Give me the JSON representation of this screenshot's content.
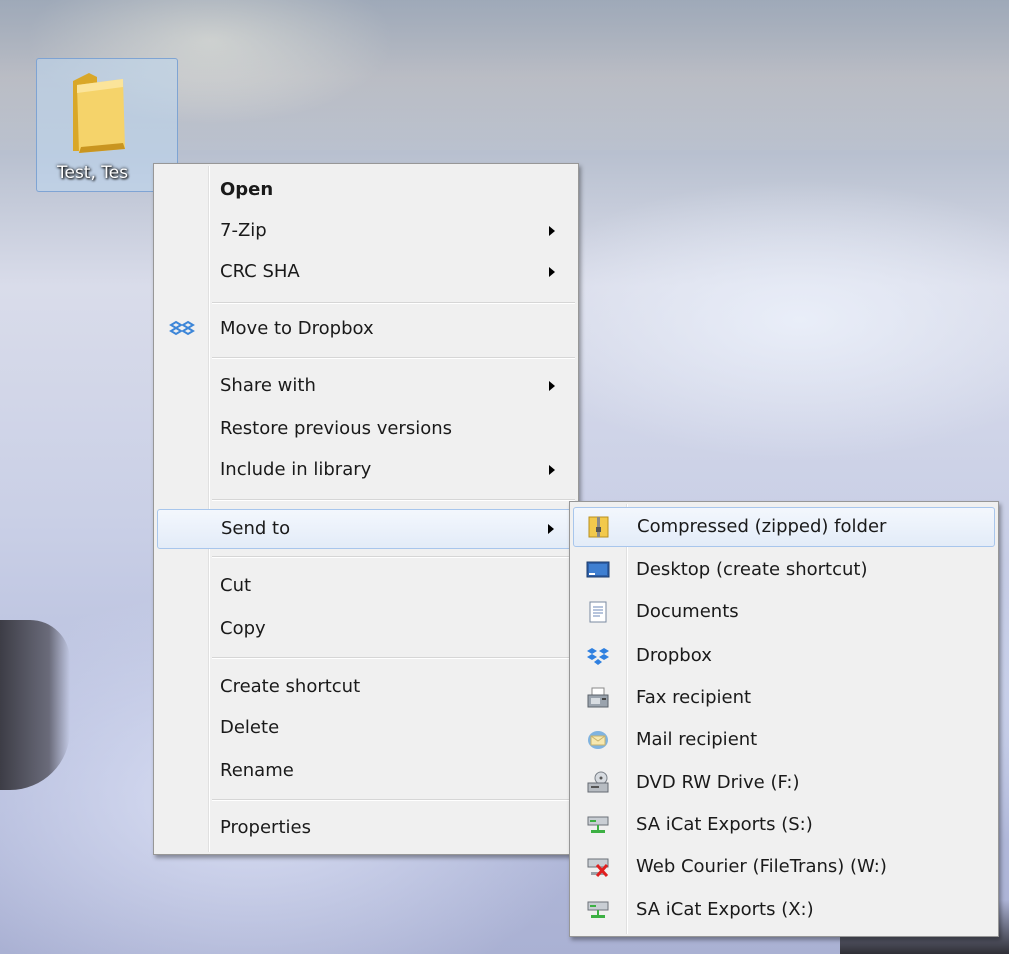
{
  "desktop": {
    "icon_label": "Test, Tes"
  },
  "context_menu": {
    "items": [
      {
        "label": "Open"
      },
      {
        "label": "7-Zip"
      },
      {
        "label": "CRC SHA"
      },
      {
        "label": "Move to Dropbox"
      },
      {
        "label": "Share with"
      },
      {
        "label": "Restore previous versions"
      },
      {
        "label": "Include in library"
      },
      {
        "label": "Send to"
      },
      {
        "label": "Cut"
      },
      {
        "label": "Copy"
      },
      {
        "label": "Create shortcut"
      },
      {
        "label": "Delete"
      },
      {
        "label": "Rename"
      },
      {
        "label": "Properties"
      }
    ]
  },
  "send_to_menu": {
    "items": [
      {
        "label": "Compressed (zipped) folder",
        "icon": "zip-folder-icon"
      },
      {
        "label": "Desktop (create shortcut)",
        "icon": "desktop-icon"
      },
      {
        "label": "Documents",
        "icon": "document-icon"
      },
      {
        "label": "Dropbox",
        "icon": "dropbox-icon"
      },
      {
        "label": "Fax recipient",
        "icon": "fax-icon"
      },
      {
        "label": "Mail recipient",
        "icon": "mail-icon"
      },
      {
        "label": "DVD RW Drive (F:)",
        "icon": "dvd-drive-icon"
      },
      {
        "label": "SA iCat Exports (S:)",
        "icon": "network-drive-icon"
      },
      {
        "label": "Web Courier (FileTrans) (W:)",
        "icon": "disconnected-network-drive-icon"
      },
      {
        "label": "SA iCat Exports (X:)",
        "icon": "network-drive-icon"
      }
    ]
  },
  "colors": {
    "menu_background": "#f0f0f0",
    "highlight_border": "#a8c6ec",
    "folder_yellow": "#f2c94c"
  }
}
